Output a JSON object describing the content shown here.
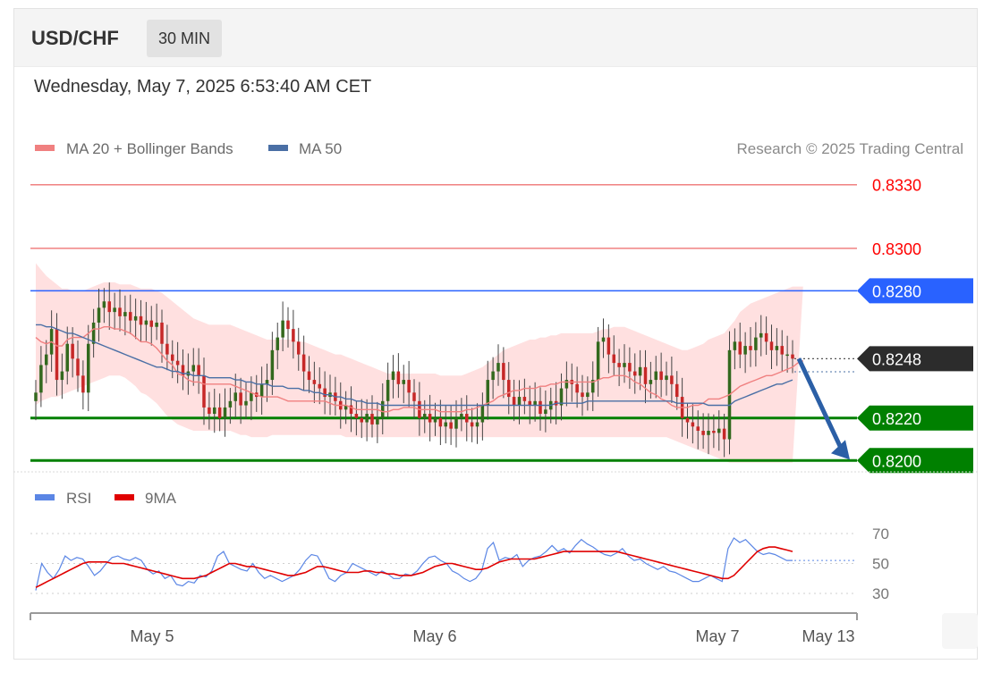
{
  "header": {
    "pair": "USD/CHF",
    "timeframe": "30 MIN"
  },
  "datetime": "Wednesday, May 7, 2025 6:53:40 AM CET",
  "legend": {
    "ma20_bb": "MA 20 + Bollinger Bands",
    "ma50": "MA 50",
    "copyright": "Research © 2025 Trading Central"
  },
  "colors": {
    "resistance": "#f08080",
    "resistance_text": "#ff0000",
    "pivot": "#2962ff",
    "support": "#008000",
    "bollinger": "#ffd6d6",
    "ma20": "#f08080",
    "ma50": "#4a6fa5",
    "up": "#33691e",
    "down": "#c62828",
    "arrow": "#2b5fa6",
    "rsi": "#5b86e5",
    "rsi_ma": "#e00000"
  },
  "chart_data": [
    {
      "type": "candlestick",
      "title": "USD/CHF",
      "timeframe": "30 MIN",
      "ylim": [
        0.8198,
        0.834
      ],
      "x_ticks": [
        "May 5",
        "May 6",
        "May 7",
        "May 13"
      ],
      "levels": [
        {
          "label": "0.8330",
          "value": 0.833,
          "kind": "resistance"
        },
        {
          "label": "0.8300",
          "value": 0.83,
          "kind": "resistance"
        },
        {
          "label": "0.8280",
          "value": 0.828,
          "kind": "pivot"
        },
        {
          "label": "0.8248",
          "value": 0.8248,
          "kind": "last"
        },
        {
          "label": "0.8220",
          "value": 0.822,
          "kind": "support"
        },
        {
          "label": "0.8200",
          "value": 0.82,
          "kind": "support"
        }
      ],
      "close": [
        0.8232,
        0.8245,
        0.825,
        0.8262,
        0.8238,
        0.8242,
        0.8255,
        0.8248,
        0.824,
        0.8232,
        0.8255,
        0.8265,
        0.8272,
        0.8275,
        0.827,
        0.8272,
        0.8268,
        0.827,
        0.8266,
        0.8268,
        0.8264,
        0.8266,
        0.8263,
        0.8265,
        0.8255,
        0.825,
        0.8247,
        0.8245,
        0.824,
        0.8242,
        0.8245,
        0.824,
        0.8225,
        0.8222,
        0.8225,
        0.822,
        0.8225,
        0.8228,
        0.8232,
        0.8226,
        0.8228,
        0.8232,
        0.823,
        0.8236,
        0.8238,
        0.8252,
        0.8258,
        0.8266,
        0.8262,
        0.8256,
        0.825,
        0.8242,
        0.8238,
        0.8236,
        0.8234,
        0.823,
        0.8232,
        0.8228,
        0.8224,
        0.8226,
        0.8222,
        0.822,
        0.8218,
        0.8222,
        0.8217,
        0.822,
        0.8228,
        0.8238,
        0.8242,
        0.8236,
        0.8238,
        0.8232,
        0.8228,
        0.822,
        0.8222,
        0.8218,
        0.822,
        0.8216,
        0.8218,
        0.8215,
        0.822,
        0.8222,
        0.8218,
        0.8216,
        0.8218,
        0.8226,
        0.8238,
        0.8242,
        0.8246,
        0.8238,
        0.823,
        0.8226,
        0.823,
        0.8228,
        0.8226,
        0.8228,
        0.8222,
        0.8224,
        0.8228,
        0.8226,
        0.8234,
        0.8238,
        0.8236,
        0.8232,
        0.823,
        0.8232,
        0.8238,
        0.8256,
        0.8258,
        0.825,
        0.8246,
        0.8244,
        0.8246,
        0.8242,
        0.824,
        0.8244,
        0.8236,
        0.8238,
        0.8242,
        0.8238,
        0.824,
        0.8236,
        0.823,
        0.822,
        0.8218,
        0.8216,
        0.8214,
        0.8212,
        0.8214,
        0.8213,
        0.8215,
        0.821,
        0.8252,
        0.8256,
        0.825,
        0.8254,
        0.8252,
        0.8258,
        0.826,
        0.8256,
        0.8252,
        0.8254,
        0.825,
        0.825,
        0.8248
      ],
      "ma20": [
        0.8258,
        0.8256,
        0.8255,
        0.8256,
        0.8254,
        0.8254,
        0.8257,
        0.8258,
        0.8258,
        0.8258,
        0.826,
        0.8262,
        0.8262,
        0.8263,
        0.8263,
        0.8262,
        0.8262,
        0.8261,
        0.826,
        0.8258,
        0.8256,
        0.8256,
        0.8255,
        0.8253,
        0.825,
        0.8247,
        0.8245,
        0.8241,
        0.824,
        0.8238,
        0.8237,
        0.8237,
        0.8236,
        0.8236,
        0.8236,
        0.8236,
        0.8236,
        0.8236,
        0.8235,
        0.8234,
        0.8233,
        0.8232,
        0.8231,
        0.823,
        0.823,
        0.823,
        0.823,
        0.8229,
        0.8228,
        0.8228,
        0.8228,
        0.8228,
        0.8228,
        0.8228,
        0.8228,
        0.8228,
        0.8227,
        0.8226,
        0.8226,
        0.8226,
        0.8225,
        0.8224,
        0.8224,
        0.8224,
        0.8224,
        0.8224,
        0.8223,
        0.8223,
        0.8224,
        0.8224,
        0.8225,
        0.8225,
        0.8225,
        0.8224,
        0.8224,
        0.8224,
        0.8224,
        0.8223,
        0.8223,
        0.8223,
        0.8223,
        0.8223,
        0.8224,
        0.8224,
        0.8225,
        0.8226,
        0.8227,
        0.8228,
        0.823,
        0.8231,
        0.8232,
        0.8233,
        0.8233,
        0.8234,
        0.8234,
        0.8234,
        0.8235,
        0.8235,
        0.8236,
        0.8236,
        0.8237,
        0.8237,
        0.8237,
        0.8237,
        0.8237,
        0.8237,
        0.8237,
        0.8238,
        0.8239,
        0.8239,
        0.824,
        0.824,
        0.824,
        0.8239,
        0.8237,
        0.8236,
        0.8234,
        0.8232,
        0.8231,
        0.8229,
        0.8228,
        0.8226,
        0.8225,
        0.8225,
        0.8225,
        0.8226,
        0.8226,
        0.8227,
        0.8229,
        0.8229,
        0.8229,
        0.823,
        0.8231,
        0.8233,
        0.8235,
        0.8236,
        0.8237,
        0.8238,
        0.8239,
        0.824,
        0.824,
        0.8241,
        0.8242,
        0.8243,
        0.8244,
        0.8246,
        0.8247
      ],
      "ma50": [
        0.8264,
        0.8264,
        0.8263,
        0.8263,
        0.8262,
        0.8261,
        0.826,
        0.826,
        0.8259,
        0.8258,
        0.8257,
        0.8256,
        0.8255,
        0.8254,
        0.8253,
        0.8252,
        0.8251,
        0.825,
        0.8249,
        0.8248,
        0.8247,
        0.8246,
        0.8245,
        0.8244,
        0.8244,
        0.8243,
        0.8242,
        0.8242,
        0.8241,
        0.8241,
        0.824,
        0.824,
        0.824,
        0.8239,
        0.8239,
        0.8239,
        0.8239,
        0.8239,
        0.8238,
        0.8238,
        0.8237,
        0.8237,
        0.8236,
        0.8236,
        0.8236,
        0.8235,
        0.8235,
        0.8235,
        0.8234,
        0.8234,
        0.8234,
        0.8233,
        0.8233,
        0.8232,
        0.8232,
        0.8231,
        0.8231,
        0.823,
        0.823,
        0.8229,
        0.8229,
        0.8228,
        0.8228,
        0.8227,
        0.8227,
        0.8227,
        0.8226,
        0.8226,
        0.8226,
        0.8226,
        0.8226,
        0.8226,
        0.8226,
        0.8226,
        0.8226,
        0.8226,
        0.8226,
        0.8226,
        0.8226,
        0.8226,
        0.8226,
        0.8226,
        0.8226,
        0.8226,
        0.8226,
        0.8226,
        0.8226,
        0.8226,
        0.8226,
        0.8226,
        0.8226,
        0.8226,
        0.8226,
        0.8226,
        0.8226,
        0.8226,
        0.8226,
        0.8226,
        0.8226,
        0.8227,
        0.8227,
        0.8227,
        0.8227,
        0.8227,
        0.8227,
        0.8228,
        0.8228,
        0.8228,
        0.8228,
        0.8228,
        0.8228,
        0.8228,
        0.8228,
        0.8228,
        0.8228,
        0.8228,
        0.8228,
        0.8228,
        0.8228,
        0.8228,
        0.8228,
        0.8228,
        0.8227,
        0.8227,
        0.8227,
        0.8227,
        0.8227,
        0.8227,
        0.8226,
        0.8226,
        0.8226,
        0.8226,
        0.8226,
        0.8228,
        0.8229,
        0.823,
        0.8231,
        0.8232,
        0.8233,
        0.8234,
        0.8235,
        0.8236,
        0.8236,
        0.8237,
        0.8238
      ],
      "bb_upper": [
        0.8293,
        0.829,
        0.8287,
        0.8285,
        0.8283,
        0.8281,
        0.8281,
        0.828,
        0.828,
        0.828,
        0.8281,
        0.8282,
        0.8283,
        0.8284,
        0.8284,
        0.8284,
        0.8283,
        0.8283,
        0.8283,
        0.8282,
        0.8281,
        0.8281,
        0.8281,
        0.828,
        0.8279,
        0.8277,
        0.8275,
        0.8273,
        0.8271,
        0.8269,
        0.8267,
        0.8266,
        0.8265,
        0.8264,
        0.8264,
        0.8264,
        0.8264,
        0.8264,
        0.8263,
        0.8262,
        0.8261,
        0.826,
        0.8259,
        0.8258,
        0.8257,
        0.8257,
        0.8257,
        0.8257,
        0.8257,
        0.8257,
        0.8256,
        0.8256,
        0.8255,
        0.8254,
        0.8253,
        0.8252,
        0.8251,
        0.825,
        0.825,
        0.8249,
        0.8248,
        0.8247,
        0.8246,
        0.8245,
        0.8244,
        0.8243,
        0.8242,
        0.8241,
        0.8241,
        0.8241,
        0.8241,
        0.8241,
        0.8241,
        0.8241,
        0.8241,
        0.8241,
        0.8241,
        0.824,
        0.824,
        0.824,
        0.824,
        0.824,
        0.8241,
        0.8242,
        0.8243,
        0.8244,
        0.8246,
        0.8248,
        0.825,
        0.8252,
        0.8253,
        0.8254,
        0.8255,
        0.8256,
        0.8257,
        0.8257,
        0.8258,
        0.8258,
        0.8259,
        0.8259,
        0.826,
        0.826,
        0.826,
        0.826,
        0.826,
        0.826,
        0.826,
        0.8261,
        0.8262,
        0.8262,
        0.8263,
        0.8263,
        0.8263,
        0.8262,
        0.8261,
        0.826,
        0.8259,
        0.8258,
        0.8257,
        0.8256,
        0.8255,
        0.8254,
        0.8253,
        0.8252,
        0.8252,
        0.8253,
        0.8254,
        0.8255,
        0.8257,
        0.8258,
        0.8259,
        0.826,
        0.8263,
        0.8266,
        0.827,
        0.8272,
        0.8274,
        0.8275,
        0.8276,
        0.8277,
        0.8278,
        0.8279,
        0.828,
        0.8281,
        0.8282,
        0.8282,
        0.8282
      ],
      "bb_lower": [
        0.8226,
        0.8228,
        0.8229,
        0.823,
        0.823,
        0.8231,
        0.8232,
        0.8233,
        0.8234,
        0.8235,
        0.8236,
        0.8237,
        0.8238,
        0.8239,
        0.824,
        0.824,
        0.824,
        0.8239,
        0.8237,
        0.8235,
        0.8232,
        0.8231,
        0.8229,
        0.8227,
        0.8224,
        0.8221,
        0.8219,
        0.8217,
        0.8216,
        0.8215,
        0.8214,
        0.8214,
        0.8214,
        0.8214,
        0.8214,
        0.8214,
        0.8214,
        0.8214,
        0.8213,
        0.8212,
        0.8212,
        0.8211,
        0.8211,
        0.8211,
        0.8211,
        0.8212,
        0.8212,
        0.8212,
        0.8212,
        0.8212,
        0.8212,
        0.8212,
        0.8212,
        0.8212,
        0.8212,
        0.8212,
        0.8212,
        0.8212,
        0.8212,
        0.8211,
        0.8211,
        0.8211,
        0.8211,
        0.8211,
        0.8211,
        0.8211,
        0.8211,
        0.8211,
        0.8211,
        0.8211,
        0.8211,
        0.8211,
        0.8211,
        0.8211,
        0.8211,
        0.8211,
        0.8211,
        0.8211,
        0.8211,
        0.8211,
        0.8211,
        0.8211,
        0.8211,
        0.8211,
        0.8211,
        0.8211,
        0.8211,
        0.8211,
        0.8211,
        0.8211,
        0.8211,
        0.8211,
        0.8211,
        0.8211,
        0.8211,
        0.8211,
        0.8211,
        0.8211,
        0.8211,
        0.8211,
        0.8211,
        0.8211,
        0.8211,
        0.8211,
        0.8211,
        0.8211,
        0.8211,
        0.8211,
        0.8211,
        0.8211,
        0.8211,
        0.8211,
        0.8211,
        0.8211,
        0.8211,
        0.8211,
        0.8211,
        0.8211,
        0.8211,
        0.8211,
        0.8211,
        0.821,
        0.8209,
        0.8208,
        0.8207,
        0.8206,
        0.8205,
        0.8204,
        0.8203,
        0.8202,
        0.8201,
        0.82,
        0.8199,
        0.8199,
        0.8199,
        0.8199,
        0.8199,
        0.8199,
        0.8199,
        0.8199,
        0.8199,
        0.8199,
        0.8199,
        0.8199,
        0.8199,
        0.8199,
        0.8199
      ],
      "forecast": {
        "from": 0.8248,
        "to": 0.82
      }
    },
    {
      "type": "line",
      "series": [
        {
          "name": "RSI",
          "values": [
            32,
            50,
            44,
            40,
            46,
            55,
            52,
            54,
            53,
            48,
            42,
            45,
            50,
            54,
            55,
            53,
            52,
            54,
            52,
            46,
            43,
            45,
            40,
            42,
            36,
            35,
            38,
            37,
            42,
            41,
            45,
            55,
            58,
            50,
            48,
            46,
            45,
            50,
            44,
            40,
            42,
            40,
            38,
            40,
            42,
            46,
            52,
            56,
            55,
            48,
            40,
            38,
            42,
            44,
            50,
            48,
            46,
            44,
            42,
            45,
            43,
            40,
            40,
            43,
            42,
            45,
            50,
            54,
            55,
            52,
            50,
            45,
            43,
            40,
            38,
            40,
            45,
            60,
            64,
            52,
            54,
            53,
            56,
            48,
            52,
            54,
            55,
            58,
            62,
            58,
            60,
            57,
            62,
            66,
            63,
            61,
            58,
            56,
            55,
            57,
            60,
            55,
            52,
            53,
            50,
            48,
            46,
            48,
            45,
            44,
            42,
            40,
            38,
            38,
            40,
            42,
            40,
            38,
            60,
            67,
            64,
            66,
            62,
            58,
            56,
            57,
            56,
            54,
            52,
            52
          ]
        },
        {
          "name": "9MA",
          "values": [
            34,
            36,
            38,
            40,
            42,
            44,
            46,
            48,
            50,
            51,
            51,
            51,
            51,
            50,
            50,
            50,
            49,
            48,
            47,
            46,
            45,
            44,
            43,
            42,
            41,
            40,
            40,
            40,
            41,
            42,
            44,
            46,
            48,
            50,
            50,
            49,
            48,
            48,
            47,
            46,
            45,
            44,
            43,
            42,
            42,
            43,
            44,
            46,
            48,
            48,
            47,
            46,
            45,
            44,
            44,
            44,
            45,
            45,
            44,
            44,
            43,
            43,
            42,
            42,
            42,
            43,
            44,
            46,
            48,
            49,
            50,
            50,
            49,
            48,
            47,
            46,
            46,
            47,
            49,
            51,
            52,
            53,
            53,
            53,
            53,
            53,
            54,
            55,
            56,
            57,
            58,
            58,
            58,
            58,
            58,
            58,
            58,
            58,
            58,
            58,
            57,
            56,
            55,
            54,
            53,
            52,
            51,
            50,
            49,
            48,
            47,
            46,
            45,
            44,
            43,
            42,
            41,
            40,
            40,
            42,
            46,
            50,
            54,
            58,
            60,
            61,
            61,
            60,
            59,
            58
          ]
        }
      ],
      "x_ticks": [
        "May 5",
        "May 6",
        "May 7",
        "May 13"
      ],
      "y_ticks": [
        "70",
        "50",
        "30"
      ],
      "ylim": [
        20,
        80
      ]
    }
  ]
}
